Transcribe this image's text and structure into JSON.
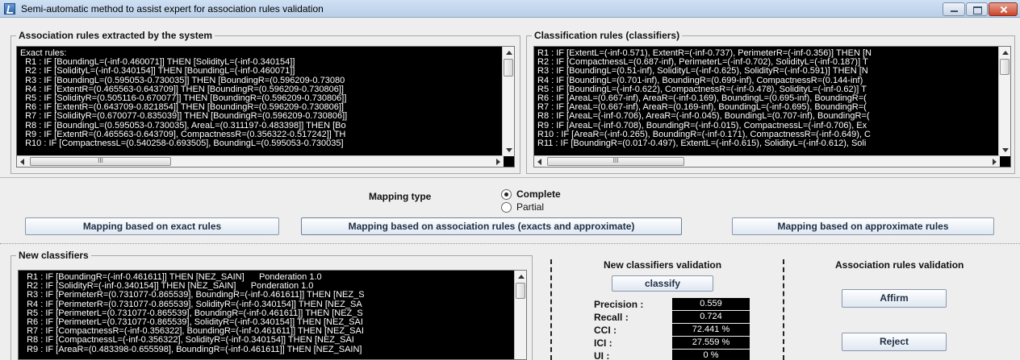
{
  "window": {
    "title": "Semi-automatic method to assist expert for association rules validation"
  },
  "association_panel": {
    "title": "Association rules extracted by the system",
    "lines": [
      "Exact rules:",
      "  R1 : IF [BoundingL=(-inf-0.460071]] THEN [SolidityL=(-inf-0.340154]]",
      "  R2 : IF [SolidityL=(-inf-0.340154]] THEN [BoundingL=(-inf-0.460071]]",
      "  R3 : IF [BoundingL=(0.595053-0.730035]] THEN [BoundingR=(0.596209-0.73080",
      "  R4 : IF [ExtentR=(0.465563-0.643709]] THEN [BoundingR=(0.596209-0.730806]]",
      "  R5 : IF [SolidityR=(0.505116-0.670077]] THEN [BoundingR=(0.596209-0.730806]]",
      "  R6 : IF [ExtentR=(0.643709-0.821854]] THEN [BoundingR=(0.596209-0.730806]]",
      "  R7 : IF [SolidityR=(0.670077-0.835039]] THEN [BoundingR=(0.596209-0.730806]]",
      "  R8 : IF [BoundingL=(0.595053-0.730035], AreaL=(0.311197-0.483398]] THEN [Bo",
      "  R9 : IF [ExtentR=(0.465563-0.643709], CompactnessR=(0.356322-0.517242]] TH",
      "  R10 : IF [CompactnessL=(0.540258-0.693505], BoundingL=(0.595053-0.730035]"
    ]
  },
  "classification_panel": {
    "title": "Classification rules (classifiers)",
    "lines": [
      "R1 : IF [ExtentL=(-inf-0.571), ExtentR=(-inf-0.737), PerimeterR=(-inf-0.356)] THEN [N",
      "R2 : IF [CompactnessL=(0.687-inf), PerimeterL=(-inf-0.702), SolidityL=(-inf-0.187)] T",
      "R3 : IF [BoundingL=(0.51-inf), SolidityL=(-inf-0.625), SolidityR=(-inf-0.591)] THEN [N",
      "R4 : IF [BoundingL=(0.701-inf), BoundingR=(0.699-inf), CompactnessR=(0.144-inf)",
      "R5 : IF [BoundingL=(-inf-0.622), CompactnessR=(-inf-0.478), SolidityL=(-inf-0.62)] T",
      "R6 : IF [AreaL=(0.667-inf), AreaR=(-inf-0.169), BoundingL=(0.695-inf), BoundingR=(",
      "R7 : IF [AreaL=(0.667-inf), AreaR=(0.169-inf), BoundingL=(-inf-0.695), BoundingR=(",
      "R8 : IF [AreaL=(-inf-0.706), AreaR=(-inf-0.045), BoundingL=(0.707-inf), BoundingR=(",
      "R9 : IF [AreaL=(-inf-0.708), BoundingR=(-inf-0.015), CompactnessL=(-inf-0.706), Ex",
      "R10 : IF [AreaR=(-inf-0.265), BoundingR=(-inf-0.171), CompactnessR=(-inf-0.649), C",
      "R11 : IF [BoundingR=(0.017-0.497), ExtentL=(-inf-0.615), SolidityL=(-inf-0.612), Soli"
    ]
  },
  "mapping": {
    "label": "Mapping type",
    "options": [
      {
        "label": "Complete",
        "checked": true
      },
      {
        "label": "Partial",
        "checked": false
      }
    ],
    "btn_exact": "Mapping based on exact rules",
    "btn_assoc": "Mapping based on association rules (exacts and approximate)",
    "btn_approx": "Mapping based on approximate rules"
  },
  "new_classifiers": {
    "title": "New classifiers",
    "lines": [
      "  R1 : IF [BoundingR=(-inf-0.461611]] THEN [NEZ_SAIN]      Ponderation 1.0",
      "  R2 : IF [SolidityR=(-inf-0.340154]] THEN [NEZ_SAIN]      Ponderation 1.0",
      "  R3 : IF [PerimeterR=(0.731077-0.865539], BoundingR=(-inf-0.461611]] THEN [NEZ_S",
      "  R4 : IF [PerimeterR=(0.731077-0.865539], SolidityR=(-inf-0.340154]] THEN [NEZ_SA",
      "  R5 : IF [PerimeterL=(0.731077-0.865539], BoundingR=(-inf-0.461611]] THEN [NEZ_S",
      "  R6 : IF [PerimeterL=(0.731077-0.865539], SolidityR=(-inf-0.340154]] THEN [NEZ_SAI",
      "  R7 : IF [CompactnessR=(-inf-0.356322], BoundingR=(-inf-0.461611]] THEN [NEZ_SAI",
      "  R8 : IF [CompactnessL=(-inf-0.356322], SolidityR=(-inf-0.340154]] THEN [NEZ_SAI",
      "  R9 : IF [AreaR=(0.483398-0.655598], BoundingR=(-inf-0.461611]] THEN [NEZ_SAIN]"
    ]
  },
  "validation": {
    "title": "New classifiers validation",
    "classify_btn": "classify",
    "metrics": [
      {
        "label": "Precision :",
        "value": "0.559"
      },
      {
        "label": "Recall :",
        "value": "0.724"
      },
      {
        "label": "CCI :",
        "value": "72.441 %"
      },
      {
        "label": "ICI :",
        "value": "27.559 %"
      },
      {
        "label": "UI :",
        "value": "0 %"
      }
    ]
  },
  "assoc_validation": {
    "title": "Association rules validation",
    "affirm_btn": "Affirm",
    "reject_btn": "Reject"
  },
  "scroll_glyph": "III"
}
